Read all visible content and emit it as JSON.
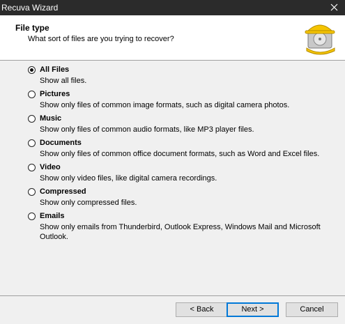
{
  "window": {
    "title": "Recuva Wizard",
    "close_icon": "close-icon"
  },
  "header": {
    "title": "File type",
    "subtitle": "What sort of files are you trying to recover?",
    "logo_icon": "recuva-hardhat-drive-icon"
  },
  "options": [
    {
      "label": "All Files",
      "description": "Show all files.",
      "checked": true
    },
    {
      "label": "Pictures",
      "description": "Show only files of common image formats, such as digital camera photos.",
      "checked": false
    },
    {
      "label": "Music",
      "description": "Show only files of common audio formats, like MP3 player files.",
      "checked": false
    },
    {
      "label": "Documents",
      "description": "Show only files of common office document formats, such as Word and Excel files.",
      "checked": false
    },
    {
      "label": "Video",
      "description": "Show only video files, like digital camera recordings.",
      "checked": false
    },
    {
      "label": "Compressed",
      "description": "Show only compressed files.",
      "checked": false
    },
    {
      "label": "Emails",
      "description": "Show only emails from Thunderbird, Outlook Express, Windows Mail and Microsoft Outlook.",
      "checked": false
    }
  ],
  "buttons": {
    "back": "< Back",
    "next": "Next >",
    "cancel": "Cancel"
  },
  "colors": {
    "titlebar": "#2b2b2b",
    "accent": "#0078d7",
    "helmet": "#f5c400"
  }
}
